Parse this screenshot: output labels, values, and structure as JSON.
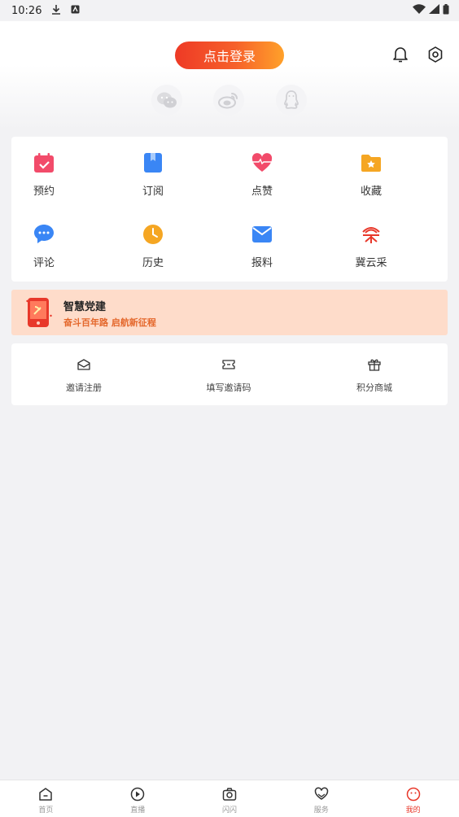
{
  "status_bar": {
    "time": "10:26"
  },
  "header": {
    "login_label": "点击登录",
    "bell_icon": "bell-icon",
    "settings_icon": "hexagon-settings-icon"
  },
  "social_logins": [
    "wechat-icon",
    "weibo-icon",
    "qq-icon"
  ],
  "grid": {
    "items": [
      {
        "label": "预约",
        "icon": "calendar-icon",
        "color": "#f24b6a"
      },
      {
        "label": "订阅",
        "icon": "bookmark-book-icon",
        "color": "#3a86f5"
      },
      {
        "label": "点赞",
        "icon": "heart-icon",
        "color": "#f24b6a"
      },
      {
        "label": "收藏",
        "icon": "folder-star-icon",
        "color": "#f5a623"
      },
      {
        "label": "评论",
        "icon": "chat-bubble-icon",
        "color": "#3a86f5"
      },
      {
        "label": "历史",
        "icon": "clock-icon",
        "color": "#f5a623"
      },
      {
        "label": "报料",
        "icon": "mail-icon",
        "color": "#3a86f5"
      },
      {
        "label": "冀云采",
        "icon": "jiyuncai-logo-icon",
        "color": "#e8382a"
      }
    ]
  },
  "party_banner": {
    "title": "智慧党建",
    "subtitle": "奋斗百年路 启航新征程"
  },
  "invite": {
    "items": [
      {
        "label": "邀请注册",
        "icon": "envelope-icon"
      },
      {
        "label": "填写邀请码",
        "icon": "ticket-icon"
      },
      {
        "label": "积分商城",
        "icon": "gift-icon"
      }
    ]
  },
  "bottom_nav": {
    "items": [
      {
        "label": "首页",
        "icon": "home-icon"
      },
      {
        "label": "直播",
        "icon": "play-icon"
      },
      {
        "label": "闪闪",
        "icon": "camera-icon"
      },
      {
        "label": "服务",
        "icon": "service-heart-icon"
      },
      {
        "label": "我的",
        "icon": "profile-face-icon",
        "active": true
      }
    ]
  },
  "colors": {
    "accent": "#e8382a",
    "login_gradient_start": "#ee3a26",
    "login_gradient_end": "#ffa12a",
    "banner_bg": "#fedcca",
    "banner_sub": "#e4672b"
  }
}
